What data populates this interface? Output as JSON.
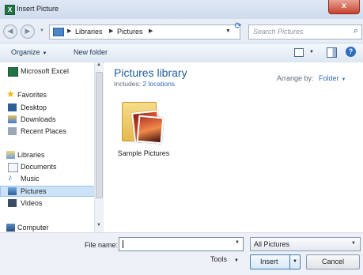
{
  "window": {
    "title": "Insert Picture",
    "app_icon_letter": "X",
    "close_glyph": "x"
  },
  "address": {
    "crumbs": [
      "Libraries",
      "Pictures"
    ],
    "search_placeholder": "Search Pictures"
  },
  "toolbar": {
    "organize_label": "Organize",
    "new_folder_label": "New folder"
  },
  "navpane": {
    "items": [
      {
        "label": "Microsoft Excel",
        "icon": "excel-icon"
      },
      {
        "label": "Favorites",
        "icon": "star-icon"
      },
      {
        "label": "Desktop",
        "icon": "desktop-icon"
      },
      {
        "label": "Downloads",
        "icon": "downloads-icon"
      },
      {
        "label": "Recent Places",
        "icon": "recent-places-icon"
      },
      {
        "label": "Libraries",
        "icon": "libraries-icon"
      },
      {
        "label": "Documents",
        "icon": "documents-icon"
      },
      {
        "label": "Music",
        "icon": "music-icon"
      },
      {
        "label": "Pictures",
        "icon": "pictures-icon",
        "selected": true
      },
      {
        "label": "Videos",
        "icon": "videos-icon"
      },
      {
        "label": "Computer",
        "icon": "computer-icon"
      }
    ]
  },
  "content": {
    "library_title": "Pictures library",
    "includes_prefix": "Includes:",
    "includes_link": "2 locations",
    "arrange_label": "Arrange by:",
    "arrange_value": "Folder",
    "folder_name": "Sample Pictures"
  },
  "bottom": {
    "file_name_label": "File name:",
    "file_name_value": "",
    "filter_value": "All Pictures",
    "tools_label": "Tools",
    "insert_label": "Insert",
    "cancel_label": "Cancel"
  },
  "colors": {
    "accent": "#2f6cc0",
    "selection": "#cde2f7",
    "close": "#c7432d"
  }
}
